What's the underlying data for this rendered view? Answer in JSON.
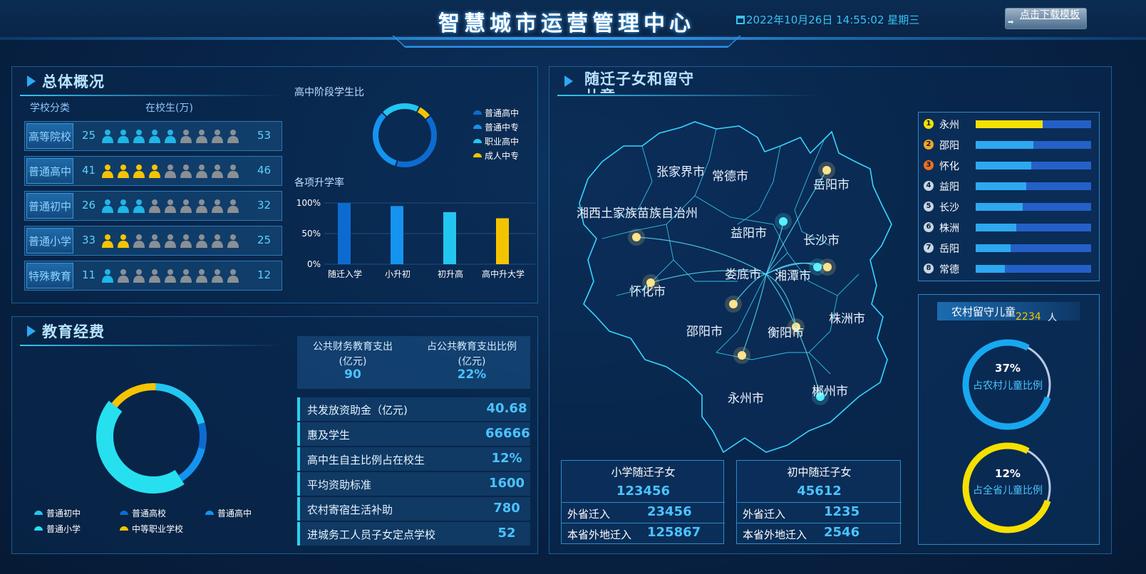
{
  "header": {
    "title": "智慧城市运营管理中心",
    "datetime": "2022年10月26日 14:55:02 星期三",
    "download_label": "点击下载模板"
  },
  "overview": {
    "title": "总体概况",
    "col_type": "学校分类",
    "col_students": "在校生(万)",
    "rows": [
      {
        "label": "高等院校",
        "left": "25",
        "right": "53",
        "filled": 5,
        "color": "#1fb6e8"
      },
      {
        "label": "普通高中",
        "left": "41",
        "right": "46",
        "filled": 4,
        "color": "#f5c400"
      },
      {
        "label": "普通初中",
        "left": "26",
        "right": "32",
        "filled": 3,
        "color": "#1fb6e8"
      },
      {
        "label": "普通小学",
        "left": "33",
        "right": "25",
        "filled": 2,
        "color": "#f5c400"
      },
      {
        "label": "特殊教育",
        "left": "11",
        "right": "12",
        "filled": 1,
        "color": "#1fb6e8"
      }
    ],
    "ratio_title": "高中阶段学生比",
    "ratio_legend": [
      "普通高中",
      "普通中专",
      "职业高中",
      "成人中专"
    ],
    "ratio_colors": [
      "#0d6bd0",
      "#1593f0",
      "#23c6f0",
      "#f5c400"
    ],
    "rate_title": "各项升学率"
  },
  "chart_data": [
    {
      "type": "pie",
      "title": "高中阶段学生比",
      "categories": [
        "普通高中",
        "普通中专",
        "职业高中",
        "成人中专"
      ],
      "values": [
        40,
        33,
        20,
        7
      ]
    },
    {
      "type": "bar",
      "title": "各项升学率",
      "categories": [
        "随迁入学",
        "小升初",
        "初升高",
        "高中升大学"
      ],
      "values": [
        100,
        95,
        85,
        75
      ],
      "colors": [
        "#0d6bd0",
        "#1593f0",
        "#23c6f0",
        "#f5c400"
      ],
      "yticks": [
        "100%",
        "50%",
        "0%"
      ],
      "ylim": [
        0,
        100
      ]
    },
    {
      "type": "pie",
      "title": "教育经费",
      "categories": [
        "普通初中",
        "普通高校",
        "普通高中",
        "普通小学",
        "中等职业学校"
      ],
      "values": [
        20,
        8,
        12,
        45,
        15
      ]
    }
  ],
  "funding": {
    "title": "教育经费",
    "public_label": "公共财务教育支出",
    "public_unit": "(亿元)",
    "public_value": "90",
    "ratio_label": "占公共教育支出比例",
    "ratio_unit": "(亿元)",
    "ratio_value": "22%",
    "items": [
      {
        "label": "共发放资助金（亿元)",
        "value": "40.68"
      },
      {
        "label": "惠及学生",
        "value": "66666"
      },
      {
        "label": "高中生自主比例占在校生",
        "value": "12%"
      },
      {
        "label": "平均资助标准",
        "value": "1600"
      },
      {
        "label": "农村寄宿生活补助",
        "value": "780"
      },
      {
        "label": "进城务工人员子女定点学校",
        "value": "52"
      }
    ],
    "legend": [
      "普通初中",
      "普通高校",
      "普通高中",
      "普通小学",
      "中等职业学校"
    ],
    "legend_colors": [
      "#23c6f0",
      "#0d6bd0",
      "#1593f0",
      "#26e0f0",
      "#f5c400"
    ]
  },
  "migrant": {
    "title": "随迁子女和留守儿童",
    "cities": [
      "张家界市",
      "常德市",
      "岳阳市",
      "湘西土家族苗族自治州",
      "益阳市",
      "长沙市",
      "娄底市",
      "湘潭市",
      "怀化市",
      "邵阳市",
      "衡阳市",
      "株洲市",
      "永州市",
      "郴州市"
    ],
    "ranking": [
      {
        "rank": "1",
        "name": "永州",
        "value": 0.58,
        "badge": "#f5e000"
      },
      {
        "rank": "2",
        "name": "邵阳",
        "value": 0.5,
        "badge": "#f5a623"
      },
      {
        "rank": "3",
        "name": "怀化",
        "value": 0.48,
        "badge": "#f07020"
      },
      {
        "rank": "4",
        "name": "益阳",
        "value": 0.44,
        "badge": "#c8d6e6"
      },
      {
        "rank": "5",
        "name": "长沙",
        "value": 0.41,
        "badge": "#c8d6e6"
      },
      {
        "rank": "6",
        "name": "株洲",
        "value": 0.35,
        "badge": "#c8d6e6"
      },
      {
        "rank": "7",
        "name": "岳阳",
        "value": 0.3,
        "badge": "#c8d6e6"
      },
      {
        "rank": "8",
        "name": "常德",
        "value": 0.25,
        "badge": "#c8d6e6"
      }
    ],
    "primary": {
      "title": "小学随迁子女",
      "total": "123456",
      "k1": "外省迁入",
      "v1": "23456",
      "k2": "本省外地迁入",
      "v2": "125867"
    },
    "junior": {
      "title": "初中随迁子女",
      "total": "45612",
      "k1": "外省迁入",
      "v1": "1235",
      "k2": "本省外地迁入",
      "v2": "2546"
    },
    "rural": {
      "title": "农村留守儿童",
      "count": "2234",
      "unit": "人",
      "p1": "37%",
      "p1_label": "占农村儿童比例",
      "p1_value": 0.37,
      "p2": "12%",
      "p2_label": "占全省儿童比例",
      "p2_value": 0.12
    }
  }
}
